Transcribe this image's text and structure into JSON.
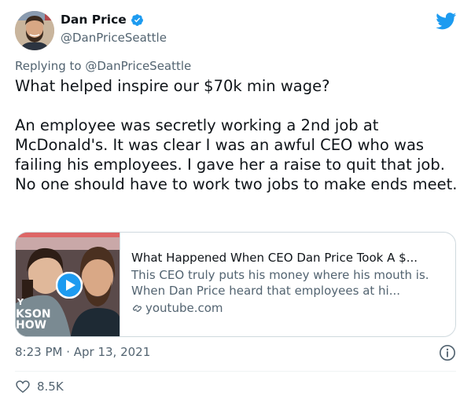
{
  "author": {
    "name": "Dan Price",
    "handle": "@DanPriceSeattle",
    "verified": true
  },
  "reply": {
    "prefix": "Replying to ",
    "mention": "@DanPriceSeattle"
  },
  "tweet": {
    "text": "What helped inspire our $70k min wage?\n\nAn employee was secretly working a 2nd job at McDonald's. It was clear I was an awful CEO who was failing his employees. I gave her a raise to quit that job. No one should have to work two jobs to make ends meet."
  },
  "card": {
    "title": "What Happened When CEO Dan Price Took A $...",
    "description": "This CEO truly puts his money where his mouth is. When Dan Price heard that employees at hi...",
    "domain": "youtube.com",
    "thumb_text": "Y\nKSON\nHOW"
  },
  "meta": {
    "timestamp": "8:23 PM · Apr 13, 2021",
    "likes": "8.5K"
  },
  "colors": {
    "brand": "#1d9bf0",
    "muted": "#536471",
    "text": "#0f1419",
    "border": "#cfd9de"
  },
  "icons": [
    "verified-badge-icon",
    "twitter-bird-icon",
    "play-icon",
    "link-icon",
    "info-icon",
    "heart-icon"
  ]
}
